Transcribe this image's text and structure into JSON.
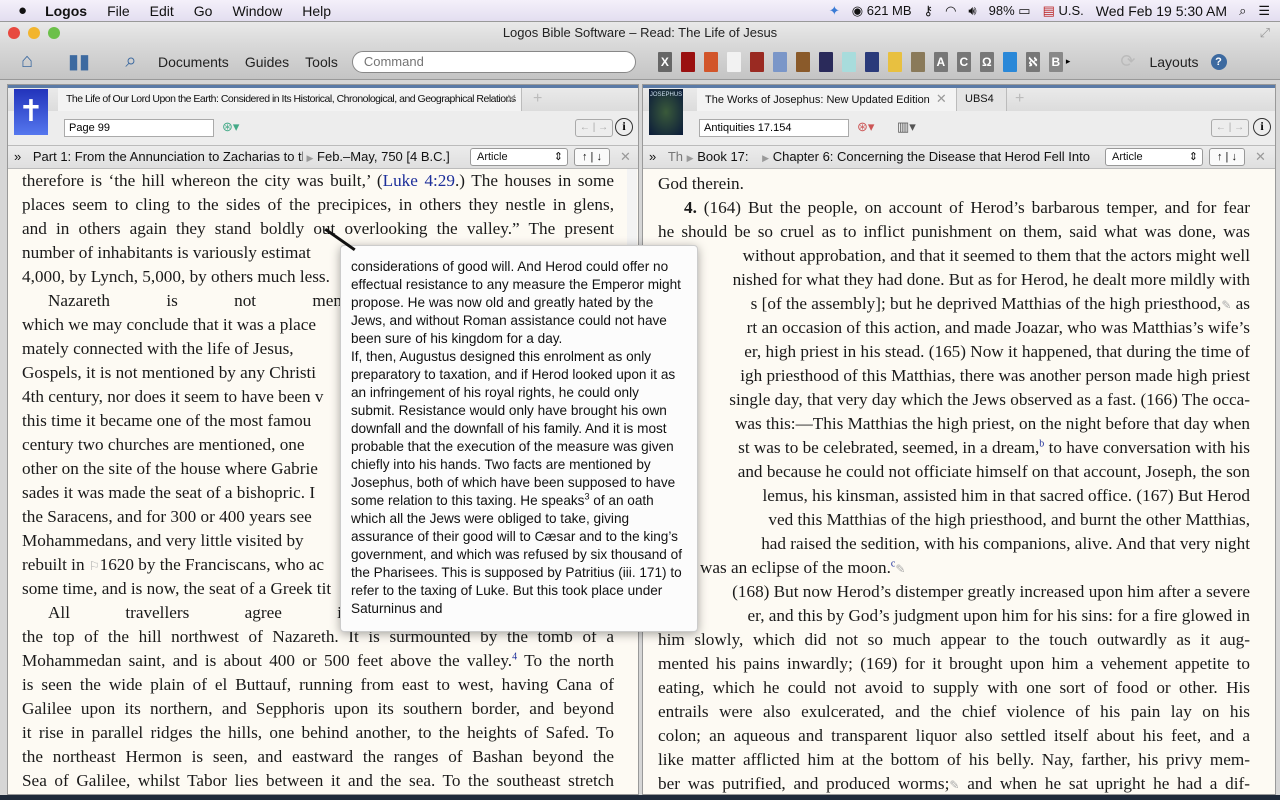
{
  "menubar": {
    "app": "Logos",
    "items": [
      "File",
      "Edit",
      "Go",
      "Window",
      "Help"
    ],
    "status": {
      "memory": "621 MB",
      "battery": "98%",
      "input_source": "U.S.",
      "datetime": "Wed Feb 19  5:30 AM"
    }
  },
  "window": {
    "title": "Logos Bible Software – Read: The Life of Jesus"
  },
  "toolbar": {
    "documents": "Documents",
    "guides": "Guides",
    "tools": "Tools",
    "command_placeholder": "Command",
    "layouts": "Layouts",
    "resources": [
      {
        "label": "X",
        "color": "#666666"
      },
      {
        "label": "",
        "color": "#9a1010"
      },
      {
        "label": "",
        "color": "#d2552a"
      },
      {
        "label": "",
        "color": "#f2f2f2"
      },
      {
        "label": "",
        "color": "#9a2a22"
      },
      {
        "label": "",
        "color": "#7a96c8"
      },
      {
        "label": "",
        "color": "#8a5a2a"
      },
      {
        "label": "",
        "color": "#2a2a5a"
      },
      {
        "label": "",
        "color": "#a8dcdc"
      },
      {
        "label": "",
        "color": "#2a3a7a"
      },
      {
        "label": "",
        "color": "#e8c040"
      },
      {
        "label": "",
        "color": "#8a7a5a"
      },
      {
        "label": "A",
        "color": "#777777"
      },
      {
        "label": "C",
        "color": "#777777"
      },
      {
        "label": "Ω",
        "color": "#777777"
      },
      {
        "label": "",
        "color": "#2a88d8"
      },
      {
        "label": "ℵ",
        "color": "#777777"
      },
      {
        "label": "B",
        "color": "#888888"
      }
    ]
  },
  "left": {
    "tab": "The Life of Our Lord Upon the Earth: Considered in Its Historical, Chronological, and Geographical Relations",
    "reference": "Page 99",
    "breadcrumb1": "Part 1: From the Annunciation to Zacharias to th",
    "breadcrumb2": "Feb.–May, 750 [4 B.C.]",
    "view": "Article",
    "lines": [
      {
        "a": "j",
        "s": [
          "therefore is ‘the hill whereon the city was built,’ (",
          {
            "link": "Luke 4:29"
          },
          ".) The houses in some"
        ]
      },
      {
        "a": "j",
        "s": [
          "places seem to cling to the sides of the precipices, in others they nestle in glens,"
        ]
      },
      {
        "a": "j",
        "s": [
          "and in others again they stand boldly out overlooking the valley.” The present"
        ]
      },
      {
        "a": "l",
        "s": [
          "number of inhabitants is variously estimat"
        ]
      },
      {
        "a": "l",
        "s": [
          "4,000, by Lynch, 5,000, by others much less."
        ]
      },
      {
        "a": "ind",
        "s": [
          "Nazareth is not mentioned in the Old"
        ]
      },
      {
        "a": "l",
        "s": [
          "which we may conclude that it was a place"
        ]
      },
      {
        "a": "l",
        "s": [
          "mately connected with the life of Jesus,"
        ]
      },
      {
        "a": "l",
        "s": [
          "Gospels, it is not mentioned by any Christi"
        ]
      },
      {
        "a": "l",
        "s": [
          "4th century, nor does it seem to have been v"
        ]
      },
      {
        "a": "l",
        "s": [
          "this time it became one of the most famou"
        ]
      },
      {
        "a": "l",
        "s": [
          "century two churches are mentioned, one"
        ]
      },
      {
        "a": "l",
        "s": [
          "other on the site of the house where Gabrie"
        ]
      },
      {
        "a": "l",
        "s": [
          "sades it was made the seat of a bishopric. I"
        ]
      },
      {
        "a": "l",
        "s": [
          "the Saracens, and for 300 or 400 years see"
        ]
      },
      {
        "a": "l",
        "s": [
          "Mohammedans, and very little visited by"
        ]
      },
      {
        "a": "l",
        "s": [
          "rebuilt in ",
          {
            "note": "⚐"
          },
          "1620 by the Franciscans, who ac"
        ]
      },
      {
        "a": "l",
        "s": [
          "some time, and is now, the seat of a Greek tit"
        ]
      },
      {
        "a": "ind",
        "s": [
          "All travellers agree in praising the ext"
        ]
      },
      {
        "a": "j",
        "s": [
          "the top of the hill northwest of Nazareth. It is surmounted by the tomb of a"
        ]
      },
      {
        "a": "j",
        "s": [
          "Mohammedan saint, and is about 400 or 500 feet above the valley.",
          {
            "sup": "4"
          },
          " To the north"
        ]
      },
      {
        "a": "j",
        "s": [
          "is seen the wide plain of el Buttauf, running from east to west, having Cana of"
        ]
      },
      {
        "a": "j",
        "s": [
          "Galilee upon its northern, and Sepphoris upon its southern border, and beyond"
        ]
      },
      {
        "a": "j",
        "s": [
          "it rise in parallel ridges the hills, one behind another, to the heights of Safed. To"
        ]
      },
      {
        "a": "j",
        "s": [
          "the northeast Hermon is seen, and eastward the ranges of Bashan beyond the"
        ]
      },
      {
        "a": "j",
        "s": [
          "Sea of Galilee, whilst Tabor lies between it and the sea. To the southeast stretch"
        ]
      }
    ]
  },
  "right": {
    "tab": "The Works of Josephus: New Updated Edition",
    "tab2": "UBS4",
    "reference": "Antiquities 17.154",
    "breadcrumb0": "Th",
    "breadcrumb1": "Book 17:",
    "breadcrumb2": "Chapter 6: Concerning the Disease that Herod Fell Into",
    "view": "Article",
    "lines": [
      {
        "a": "l",
        "s": [
          "God therein."
        ]
      },
      {
        "a": "ind",
        "s": [
          {
            "b": "4."
          },
          " (164) But the people, on account of Herod’s barbarous temper, and for fear"
        ]
      },
      {
        "a": "j",
        "s": [
          "he should be so cruel as to inflict punishment on them, said what was done, was"
        ]
      },
      {
        "a": "r",
        "s": [
          "without approbation, and that it seemed to them that the actors might well"
        ]
      },
      {
        "a": "r",
        "s": [
          "nished for what they had done. But as for Herod, he dealt more mildly with"
        ]
      },
      {
        "a": "r",
        "s": [
          "s [of the assembly]; but he deprived Matthias of the high priesthood,",
          {
            "note": "✎"
          },
          " as"
        ]
      },
      {
        "a": "r",
        "s": [
          "rt an occasion of this action, and made Joazar, who was Matthias’s wife’s"
        ]
      },
      {
        "a": "r",
        "s": [
          "er, high priest in his stead. (165) Now it happened, that during the time of"
        ]
      },
      {
        "a": "r",
        "s": [
          "igh priesthood of this Matthias, there was another person made high priest"
        ]
      },
      {
        "a": "r",
        "s": [
          "single day, that very day which the Jews observed as a fast. (166) The occa-"
        ]
      },
      {
        "a": "r",
        "s": [
          "was this:—This Matthias the high priest, on the night before that day when"
        ]
      },
      {
        "a": "r",
        "s": [
          "st was to be celebrated, seemed, in a dream,",
          {
            "sup": "b"
          },
          " to have conversation with his"
        ]
      },
      {
        "a": "r",
        "s": [
          "and because he could not officiate himself on that account, Joseph, the son"
        ]
      },
      {
        "a": "r",
        "s": [
          "lemus, his kinsman, assisted him in that sacred office. (167) But Herod"
        ]
      },
      {
        "a": "r",
        "s": [
          "ved this Matthias of the high priesthood, and burnt the other Matthias,"
        ]
      },
      {
        "a": "r",
        "s": [
          "had raised the sedition, with his companions, alive. And that very night"
        ]
      },
      {
        "a": "pl",
        "s": [
          "was an eclipse of the moon.",
          {
            "sup": "c"
          },
          {
            "note": "✎"
          }
        ]
      },
      {
        "a": "r",
        "s": [
          "(168) But now Herod’s distemper greatly increased upon him after a severe"
        ]
      },
      {
        "a": "r",
        "s": [
          "er, and this by God’s judgment upon him for his sins: for a fire glowed in"
        ]
      },
      {
        "a": "j",
        "s": [
          "him slowly, which did not so much appear to the touch outwardly as it aug-"
        ]
      },
      {
        "a": "j",
        "s": [
          "mented his pains inwardly; (169) for it brought upon him a vehement appetite to"
        ]
      },
      {
        "a": "j",
        "s": [
          "eating, which he could not avoid to supply with one sort of food or other. His"
        ]
      },
      {
        "a": "j",
        "s": [
          "entrails were also exulcerated, and the chief violence of his pain lay on his"
        ]
      },
      {
        "a": "j",
        "s": [
          "colon; an aqueous and transparent liquor also settled itself about his feet, and a"
        ]
      },
      {
        "a": "j",
        "s": [
          "like matter afflicted him at the bottom of his belly. Nay, farther, his privy mem-"
        ]
      },
      {
        "a": "j",
        "s": [
          "ber was putrified, and produced worms;",
          {
            "note": "✎"
          },
          " and when he sat upright he had a dif-"
        ]
      }
    ]
  },
  "popup": {
    "lines": [
      [
        "considerations of good will. And Herod could offer no"
      ],
      [
        "effectual resistance to any measure the Emperor might"
      ],
      [
        "propose. He was now old and greatly hated by the"
      ],
      [
        "Jews, and without Roman assistance could not have"
      ],
      [
        "been sure of his kingdom for a day."
      ],
      [
        "If, then, Augustus designed this enrolment as only"
      ],
      [
        "preparatory to taxation, and if Herod looked upon it as"
      ],
      [
        "an infringement of his royal rights, he could only"
      ],
      [
        "submit. Resistance would only have brought his own"
      ],
      [
        "downfall and the downfall of his family. And it is most"
      ],
      [
        "probable that the execution of the measure was given"
      ],
      [
        "chiefly into his hands. Two facts are mentioned by"
      ],
      [
        "Josephus, both of which have been supposed to have"
      ],
      [
        "some relation to this taxing. He speaks",
        {
          "sup": "3"
        },
        " of an oath"
      ],
      [
        "which all the Jews were obliged to take, giving"
      ],
      [
        "assurance of their good will to Cæsar and to the king’s"
      ],
      [
        "government, and which was refused by six thousand of"
      ],
      [
        "the Pharisees. This is supposed by Patritius (iii. 171) to"
      ],
      [
        "refer to the taxing of Luke. But this took place under"
      ],
      [
        "Saturninus and"
      ]
    ]
  }
}
